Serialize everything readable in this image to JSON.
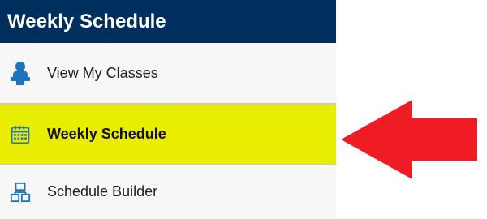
{
  "sidebar": {
    "title": "Weekly Schedule",
    "items": [
      {
        "label": "View My Classes",
        "icon": "person-icon",
        "active": false
      },
      {
        "label": "Weekly Schedule",
        "icon": "calendar-icon",
        "active": true
      },
      {
        "label": "Schedule Builder",
        "icon": "blocks-icon",
        "active": false
      }
    ]
  },
  "annotation": {
    "arrow_direction": "left",
    "arrow_color": "#ef1c24"
  },
  "colors": {
    "header_bg": "#002f5d",
    "active_bg": "#e9ed00",
    "icon_blue": "#1e73be"
  }
}
